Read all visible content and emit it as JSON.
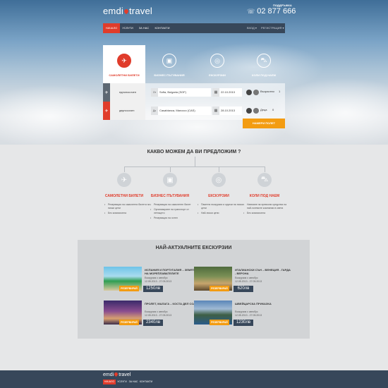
{
  "brand": {
    "name_left": "emdi",
    "name_right": "travel",
    "accent": "#e03c2b",
    "orange": "#f39c12",
    "dark": "#37475a"
  },
  "header": {
    "phone_label": "ПОДДРЪЖКА",
    "phone": "02 877 666"
  },
  "nav": {
    "items": [
      "НАЧАЛО",
      "УСЛУГИ",
      "ЗА НАС",
      "КОНТАКТИ"
    ],
    "active": 0,
    "right": [
      "ВХОД ▾",
      "РЕГИСТРАЦИЯ ▾"
    ]
  },
  "booking": {
    "tabs": [
      {
        "label": "САМОЛЕТНИ БИЛЕТИ",
        "icon": "plane-icon"
      },
      {
        "label": "БИЗНЕС ПЪТУВАНИЯ",
        "icon": "briefcase-icon"
      },
      {
        "label": "ЕКСКУРЗИИ",
        "icon": "globe-icon"
      },
      {
        "label": "КОЛИ ПОД НАЕМ",
        "icon": "car-icon"
      }
    ],
    "rows": [
      {
        "type": "еднопосочен",
        "tag": "От",
        "location": "Sofia, Bulgaria (SOF)",
        "date": "22.10.2013",
        "pax_label": "Възрастни",
        "pax": "1"
      },
      {
        "type": "двупосочен",
        "tag": "До",
        "location": "Casablanca, Marocco (CAS)",
        "date": "28.10.2013",
        "pax_label": "Деца",
        "pax": "0"
      }
    ],
    "search_button": "НАМЕРИ ПОЛЕТ"
  },
  "services": {
    "title": "КАКВО МОЖЕМ ДА ВИ ПРЕДЛОЖИМ ?",
    "items": [
      {
        "name": "САМОЛЕТНИ БИЛЕТИ",
        "features": [
          "Резервация на самолетни билети на ниски цени",
          "Без комисионна"
        ]
      },
      {
        "name": "БИЗНЕС ПЪТУВАНИЯ",
        "features": [
          "Резервация на самолетен билет",
          "Организиране на транспорт от летището",
          "Резервация на хотел"
        ]
      },
      {
        "name": "ЕКСКУРЗИИ",
        "features": [
          "Пакетни екскурзии и круизи на ниски цени",
          "Най-ниски цени"
        ]
      },
      {
        "name": "КОЛИ ПОД НАЕМ",
        "features": [
          "Наемане на превозни средства на най-големите компании в света",
          "Без комисионна"
        ]
      }
    ]
  },
  "tours": {
    "title": "НАЙ-АКТУАЛНИТЕ ЕКСКУРЗИИ",
    "badge": "РЕЗЕРВИРАЙ",
    "items": [
      {
        "title": "ИСПАНИЯ И ПОРТУГАЛИЯ – ЗЕМЯТА НА МОРЕПЛАВАТЕЛИТЕ",
        "type": "Екскурзия с автобус",
        "dates": "12.05.2013 - 27.05.2013",
        "price": "1250лв"
      },
      {
        "title": "ИТАЛИАНСКИ СЪН – ВЕНЕЦИЯ - ГАРДА - ВЕРОНА",
        "type": "Екскурзия с автобус",
        "dates": "12.05.2013 - 27.05.2013",
        "price": "620лв"
      },
      {
        "title": "ПРОЛЕТ, МАЛАГА – КОСТА ДЕЛ СОЛ",
        "type": "Екскурзия с автобус",
        "dates": "12.05.2013 - 27.05.2013",
        "price": "2340лв"
      },
      {
        "title": "ШВЕЙЦАРСКА ПРИКАЗКА",
        "type": "Екскурзия с автобус",
        "dates": "12.05.2013 - 27.05.2013",
        "price": "1230лв"
      }
    ]
  },
  "footer": {
    "nav": [
      "НАЧАЛО",
      "УСЛУГИ",
      "ЗА НАС",
      "КОНТАКТИ"
    ]
  }
}
